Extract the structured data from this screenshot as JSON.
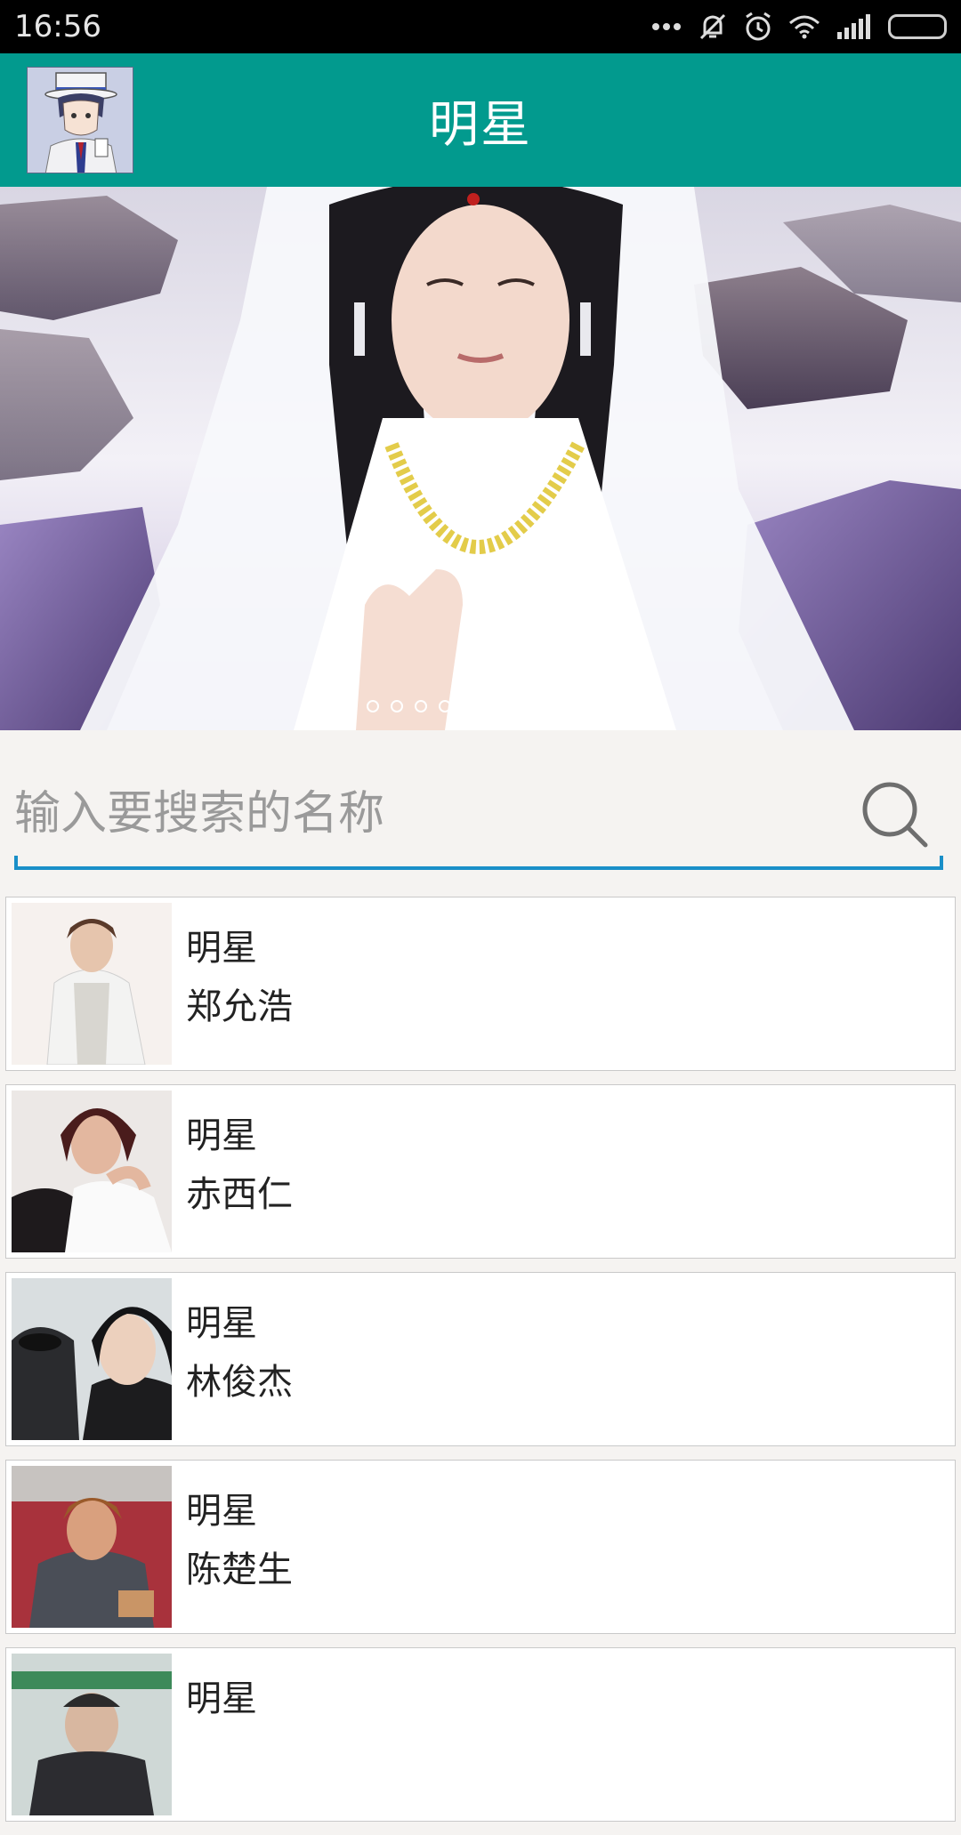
{
  "status_bar": {
    "time": "16:56",
    "icons": [
      "more-dots-icon",
      "mute-icon",
      "alarm-icon",
      "wifi-icon",
      "signal-icon",
      "battery-icon"
    ]
  },
  "app_bar": {
    "title": "明星",
    "avatar_icon": "profile-avatar"
  },
  "banner": {
    "page_count": 10,
    "active_index": 5
  },
  "search": {
    "placeholder": "输入要搜索的名称",
    "value": "",
    "icon": "search-icon",
    "accent_color": "#1a8fc8"
  },
  "list": {
    "items": [
      {
        "category": "明星",
        "name": "郑允浩"
      },
      {
        "category": "明星",
        "name": "赤西仁"
      },
      {
        "category": "明星",
        "name": "林俊杰"
      },
      {
        "category": "明星",
        "name": "陈楚生"
      },
      {
        "category": "明星",
        "name": ""
      }
    ]
  },
  "colors": {
    "app_bar": "#029a8e",
    "background": "#f5f3f1"
  }
}
